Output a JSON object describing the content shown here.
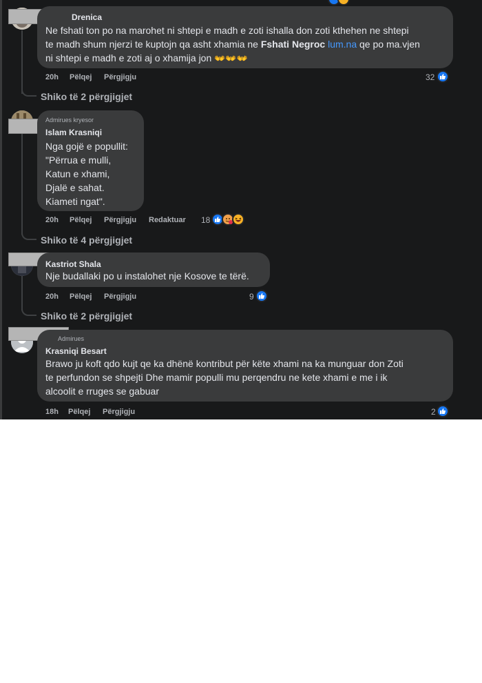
{
  "comments": [
    {
      "author": "Drenica",
      "lines": [
        "Ne fshati ton po na marohet ni shtepi e madh e zoti ishalla don zoti kthehen ne shtepi",
        "te madh shum njerzi te kuptojn qa asht xhamia ne"
      ],
      "mention": "Fshati Negroc",
      "link": "lum.na",
      "line2_tail": "qe po ma.vjen",
      "line3": "ni shtepi e madh e zoti aj o xhamija jon",
      "emoji": "👐👐👐",
      "time": "20h",
      "like_label": "Pëlqej",
      "reply_label": "Përgjigju",
      "reactions": "32",
      "view_replies": "Shiko të 2 përgjigjet"
    },
    {
      "author": "Islam Krasniqi",
      "badge": "Admirues kryesor",
      "lines": [
        "Nga gojë e popullit:",
        "\"Përrua e mulli,",
        "Katun e xhami,",
        "Djalë e sahat.",
        "Kiameti ngat\"."
      ],
      "time": "20h",
      "like_label": "Pëlqej",
      "reply_label": "Përgjigju",
      "edited_label": "Redaktuar",
      "reactions": "18",
      "view_replies": "Shiko të 4 përgjigjet"
    },
    {
      "author": "Kastriot Shala",
      "lines": [
        "Nje budallaki po u instalohet nje Kosove te tërë."
      ],
      "time": "20h",
      "like_label": "Pëlqej",
      "reply_label": "Përgjigju",
      "reactions": "9",
      "view_replies": "Shiko të 2 përgjigjet"
    },
    {
      "author": "Krasniqi Besart",
      "badge": "Admirues",
      "lines": [
        "Brawo ju koft qdo kujt qe ka dhënë kontribut për këte xhami na ka munguar don Zoti",
        "te perfundon se shpejti Dhe mamir populli mu perqendru ne kete xhami e me i ik",
        "alcoolit e rruges se gabuar"
      ],
      "time": "18h",
      "like_label": "Pëlqej",
      "reply_label": "Përgjigju",
      "reactions": "2"
    }
  ],
  "colors": {
    "background": "#18191a",
    "bubble": "#3a3b3c",
    "text": "#e4e6eb",
    "muted": "#b0b3b8",
    "like_blue": "#1877f2",
    "link": "#4599ff"
  },
  "icons": [
    "like-icon",
    "haha-icon",
    "care-icon",
    "raised-hands-emoji"
  ]
}
